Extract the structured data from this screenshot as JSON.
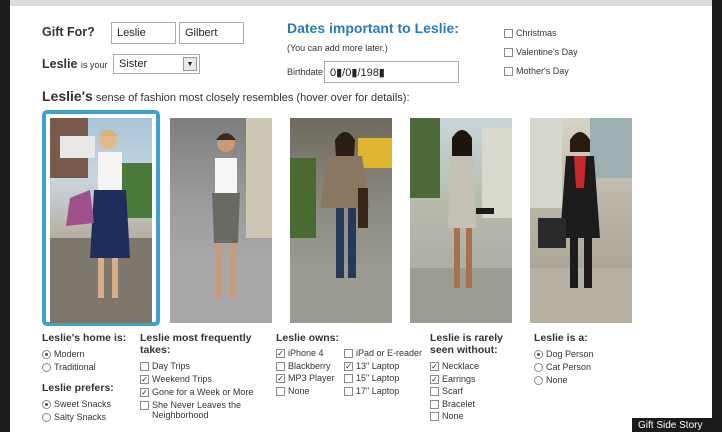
{
  "form": {
    "gift_for_label": "Gift For?",
    "first_name": "Leslie",
    "last_name": "Gilbert",
    "relation_prefix": "Leslie",
    "relation_suffix": "is your",
    "relation_value": "Sister"
  },
  "dates": {
    "title": "Dates important to Leslie:",
    "note": "(You can add more later.)",
    "birthdate_label": "Birthdate",
    "birthdate_value": "0▮/0▮/198▮",
    "holidays": [
      {
        "label": "Christmas",
        "checked": false
      },
      {
        "label": "Valentine's Day",
        "checked": false
      },
      {
        "label": "Mother's Day",
        "checked": false
      }
    ]
  },
  "fashion": {
    "prefix": "Leslie's",
    "text": "sense of fashion most closely resembles (hover over for details):",
    "selected_index": 0,
    "photos": [
      {
        "name": "photo-casual-tote"
      },
      {
        "name": "photo-tank-pencil-skirt"
      },
      {
        "name": "photo-boho-fringe"
      },
      {
        "name": "photo-sequin-dress"
      },
      {
        "name": "photo-black-red-scarf"
      }
    ]
  },
  "home": {
    "title": "Leslie's home is:",
    "options": [
      {
        "label": "Modern",
        "selected": true
      },
      {
        "label": "Traditional",
        "selected": false
      }
    ]
  },
  "prefers": {
    "title": "Leslie prefers:",
    "options": [
      {
        "label": "Sweet Snacks",
        "selected": true
      },
      {
        "label": "Salty Snacks",
        "selected": false
      }
    ]
  },
  "takes": {
    "title_line1": "Leslie most frequently",
    "title_line2": "takes:",
    "options": [
      {
        "label": "Day Trips",
        "checked": false
      },
      {
        "label": "Weekend Trips",
        "checked": true
      },
      {
        "label": "Gone for a Week or More",
        "checked": true
      },
      {
        "label": "She Never Leaves the",
        "checked": false
      },
      {
        "label": "Neighborhood",
        "checked": false
      }
    ]
  },
  "owns": {
    "title": "Leslie owns:",
    "col1": [
      {
        "label": "iPhone 4",
        "checked": true
      },
      {
        "label": "Blackberry",
        "checked": false
      },
      {
        "label": "MP3 Player",
        "checked": true
      },
      {
        "label": "None",
        "checked": false
      }
    ],
    "col2": [
      {
        "label": "iPad or E-reader",
        "checked": false
      },
      {
        "label": "13\" Laptop",
        "checked": true
      },
      {
        "label": "15\" Laptop",
        "checked": false
      },
      {
        "label": "17\" Laptop",
        "checked": false
      }
    ]
  },
  "without": {
    "title_line1": "Leslie is rarely",
    "title_line2": "seen without:",
    "options": [
      {
        "label": "Necklace",
        "checked": true
      },
      {
        "label": "Earrings",
        "checked": true
      },
      {
        "label": "Scarf",
        "checked": false
      },
      {
        "label": "Bracelet",
        "checked": false
      },
      {
        "label": "None",
        "checked": false
      }
    ]
  },
  "isa": {
    "title": "Leslie is a:",
    "options": [
      {
        "label": "Dog Person",
        "selected": true
      },
      {
        "label": "Cat Person",
        "selected": false
      },
      {
        "label": "None",
        "selected": false
      }
    ]
  },
  "caption": "Gift Side Story",
  "colors": {
    "accent": "#2a7ab6",
    "selection": "#3aa0d6"
  }
}
